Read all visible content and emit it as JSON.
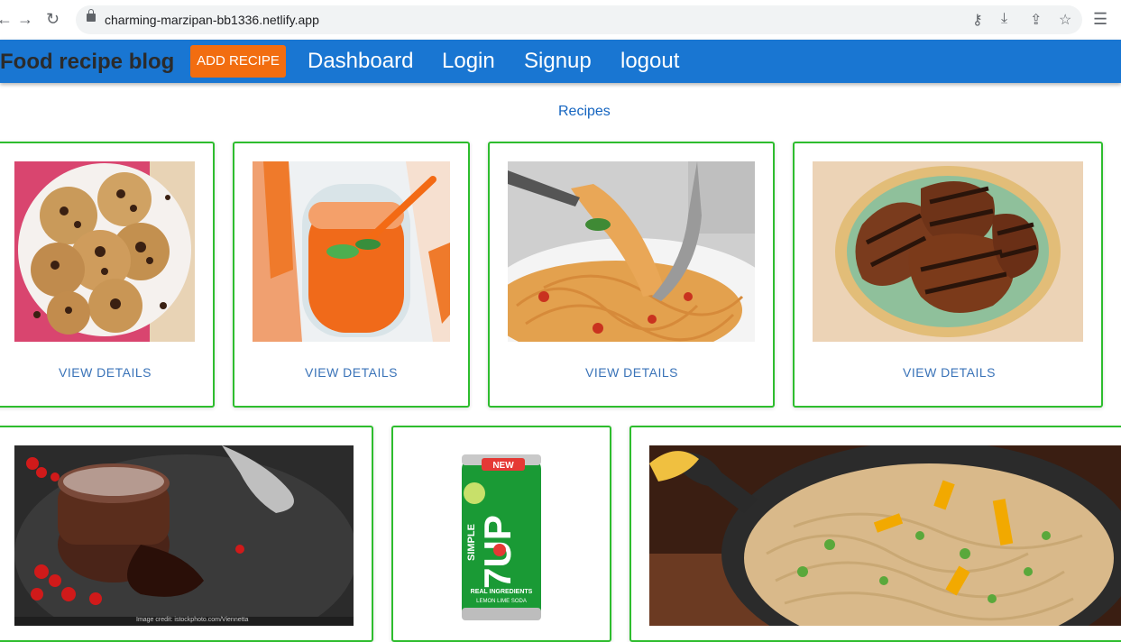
{
  "browser": {
    "url": "charming-marzipan-bb1336.netlify.app"
  },
  "appbar": {
    "brand": "Food recipe blog",
    "add_recipe": "ADD RECIPE",
    "dashboard": "Dashboard",
    "login": "Login",
    "signup": "Signup",
    "logout": "logout"
  },
  "main": {
    "title": "Recipes",
    "view_details": "VIEW DETAILS",
    "recipes": [
      {
        "image": "chocolate-chip-cookies"
      },
      {
        "image": "carrot-juice"
      },
      {
        "image": "spaghetti"
      },
      {
        "image": "grilled-chicken"
      },
      {
        "image": "chocolate-lava-cake",
        "credit": "Image credit: istockphoto.com/Viennetta"
      },
      {
        "image": "7up-can",
        "can_brand": "7UP",
        "can_simple": "SIMPLE",
        "can_new": "NEW",
        "can_ingredients": "REAL INGREDIENTS",
        "can_flavor": "LEMON LIME SODA"
      },
      {
        "image": "stir-fry-noodles"
      }
    ]
  }
}
